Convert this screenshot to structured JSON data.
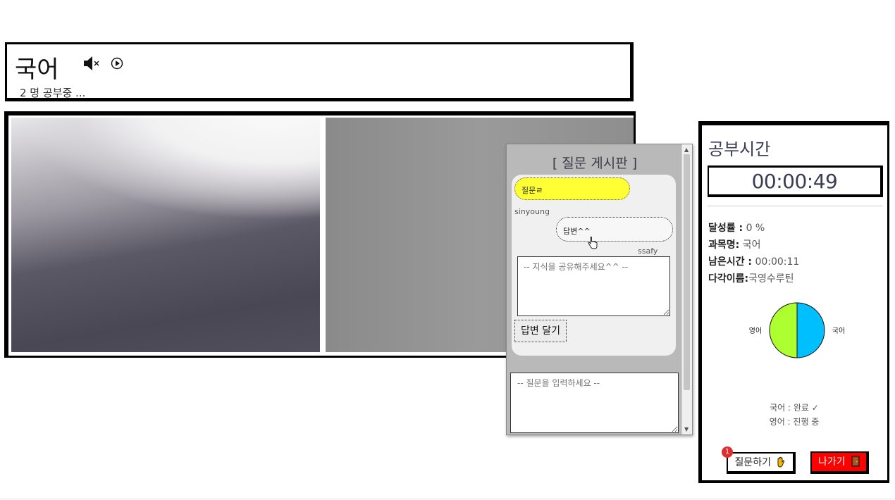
{
  "room": {
    "title": "국어",
    "participants": "2 명 공부중 ...",
    "icons": [
      "speaker-muted-icon",
      "play-circle-icon"
    ]
  },
  "question_board": {
    "title": "[ 질문 게시판 ]",
    "question": {
      "text": "질문ㄹ",
      "author": "sinyoung"
    },
    "answer": {
      "text": "답변^^",
      "author": "ssafy"
    },
    "answer_placeholder": "-- 지식을 공유해주세요^^ --",
    "answer_button": "답변 달기",
    "question_placeholder": "-- 질문을 입력하세요 --"
  },
  "panel": {
    "title": "공부시간",
    "timer": "00:00:49",
    "stats": [
      {
        "key": "달성률 :",
        "value": " 0 %"
      },
      {
        "key": "과목명:",
        "value": " 국어"
      },
      {
        "key": "남은시간 :",
        "value": " 00:00:11"
      },
      {
        "key": "다각이름:",
        "value": "국영수루틴"
      }
    ],
    "status": [
      "국어 : 완료 ✓",
      "영어 : 진행 중"
    ],
    "ask_button": "질문하기",
    "ask_badge": "1",
    "exit_button": "나가기"
  },
  "chart_data": {
    "type": "pie",
    "categories": [
      "국어",
      "영어"
    ],
    "values": [
      50,
      50
    ],
    "colors": [
      "#00bfff",
      "#adff2f"
    ]
  },
  "colors": {
    "question_bubble": "#ffff33",
    "exit_button": "#ff0000",
    "badge": "#e02d2d"
  }
}
